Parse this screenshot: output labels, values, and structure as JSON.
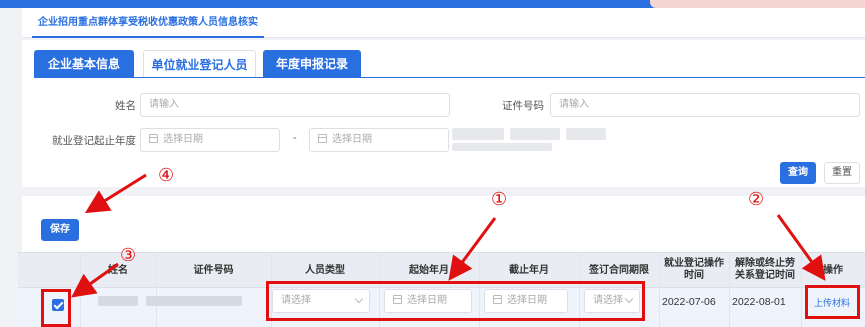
{
  "page_tab": "企业招用重点群体享受税收优惠政策人员信息核实",
  "tabs": [
    "企业基本信息",
    "单位就业登记人员",
    "年度申报记录"
  ],
  "form": {
    "name_label": "姓名",
    "name_placeholder": "请输入",
    "id_label": "证件号码",
    "id_placeholder": "请输入",
    "year_label": "就业登记起止年度",
    "start_placeholder": "选择日期",
    "range_sep": "-",
    "end_placeholder": "选择日期"
  },
  "buttons": {
    "query": "查询",
    "reset": "重置",
    "save": "保存"
  },
  "table": {
    "headers": [
      "姓名",
      "证件号码",
      "人员类型",
      "起始年月",
      "截止年月",
      "签订合同期限",
      "就业登记操作时间",
      "解除或终止劳动关系登记时间",
      "操作"
    ],
    "header_lines": {
      "reg_time": [
        "就业登记操作",
        "时间"
      ],
      "term_time": [
        "解除或终止劳",
        "关系登记时间"
      ]
    },
    "row": {
      "type_placeholder": "请选择",
      "start_placeholder": "选择日期",
      "end_placeholder": "选择日期",
      "contract_placeholder": "请选择",
      "reg_time": "2022-07-06",
      "term_time": "2022-08-01",
      "action": "上传材料"
    }
  },
  "annotations": {
    "n1": "①",
    "n2": "②",
    "n3": "③",
    "n4": "④"
  },
  "colors": {
    "primary": "#2a6fe0",
    "annotation": "#e01010"
  }
}
